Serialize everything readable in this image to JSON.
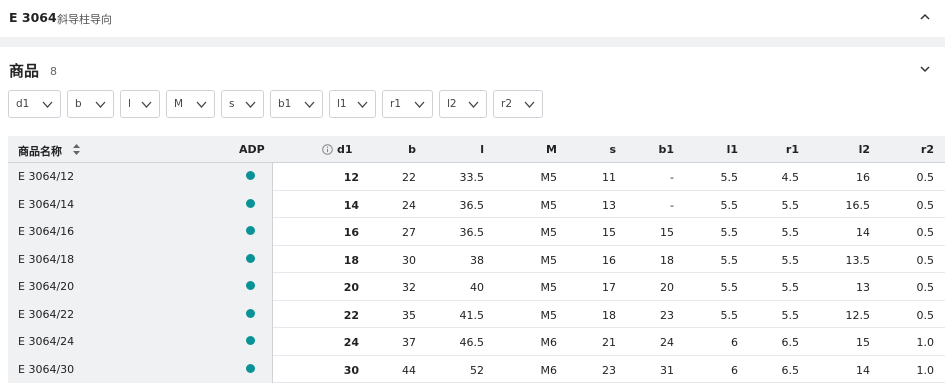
{
  "header": {
    "code": "E 3064",
    "name": "斜导柱导向",
    "chevron_icon": "chevron-up-icon"
  },
  "products": {
    "title": "商品",
    "count": "8",
    "chevron_icon": "chevron-down-icon"
  },
  "filters": [
    {
      "label": "d1"
    },
    {
      "label": "b"
    },
    {
      "label": "l"
    },
    {
      "label": "M"
    },
    {
      "label": "s"
    },
    {
      "label": "b1"
    },
    {
      "label": "l1"
    },
    {
      "label": "r1"
    },
    {
      "label": "l2"
    },
    {
      "label": "r2"
    }
  ],
  "table": {
    "columns": {
      "name": "商品名称",
      "adp": "ADP",
      "d1": "d1",
      "b": "b",
      "l": "l",
      "M": "M",
      "s": "s",
      "b1": "b1",
      "l1": "l1",
      "r1": "r1",
      "l2": "l2",
      "r2": "r2"
    },
    "rows": [
      {
        "name": "E 3064/12",
        "d1": "12",
        "b": "22",
        "l": "33.5",
        "M": "M5",
        "s": "11",
        "b1": "-",
        "l1": "5.5",
        "r1": "4.5",
        "l2": "16",
        "r2": "0.5"
      },
      {
        "name": "E 3064/14",
        "d1": "14",
        "b": "24",
        "l": "36.5",
        "M": "M5",
        "s": "13",
        "b1": "-",
        "l1": "5.5",
        "r1": "5.5",
        "l2": "16.5",
        "r2": "0.5"
      },
      {
        "name": "E 3064/16",
        "d1": "16",
        "b": "27",
        "l": "36.5",
        "M": "M5",
        "s": "15",
        "b1": "15",
        "l1": "5.5",
        "r1": "5.5",
        "l2": "14",
        "r2": "0.5"
      },
      {
        "name": "E 3064/18",
        "d1": "18",
        "b": "30",
        "l": "38",
        "M": "M5",
        "s": "16",
        "b1": "18",
        "l1": "5.5",
        "r1": "5.5",
        "l2": "13.5",
        "r2": "0.5"
      },
      {
        "name": "E 3064/20",
        "d1": "20",
        "b": "32",
        "l": "40",
        "M": "M5",
        "s": "17",
        "b1": "20",
        "l1": "5.5",
        "r1": "5.5",
        "l2": "13",
        "r2": "0.5"
      },
      {
        "name": "E 3064/22",
        "d1": "22",
        "b": "35",
        "l": "41.5",
        "M": "M5",
        "s": "18",
        "b1": "23",
        "l1": "5.5",
        "r1": "5.5",
        "l2": "12.5",
        "r2": "0.5"
      },
      {
        "name": "E 3064/24",
        "d1": "24",
        "b": "37",
        "l": "46.5",
        "M": "M6",
        "s": "21",
        "b1": "24",
        "l1": "6",
        "r1": "6.5",
        "l2": "15",
        "r2": "1.0"
      },
      {
        "name": "E 3064/30",
        "d1": "30",
        "b": "44",
        "l": "52",
        "M": "M6",
        "s": "23",
        "b1": "31",
        "l1": "6",
        "r1": "6.5",
        "l2": "14",
        "r2": "1.0"
      }
    ]
  },
  "colors": {
    "adp_dot": "#0a9396",
    "header_bg": "#f0f1f3"
  }
}
